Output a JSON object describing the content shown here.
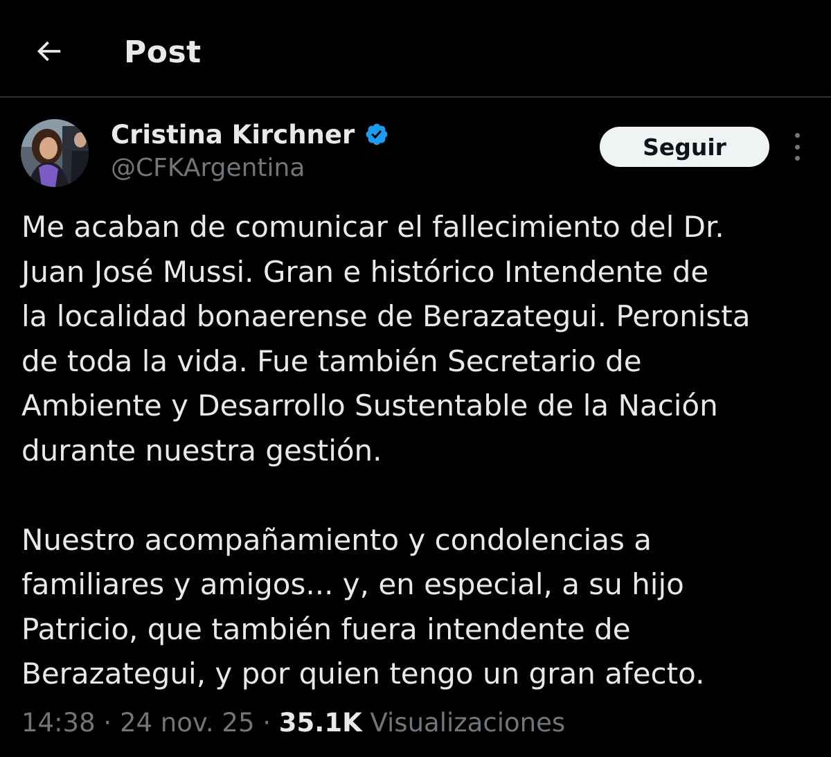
{
  "header": {
    "title": "Post",
    "back_icon": "arrow-left-icon"
  },
  "author": {
    "display_name": "Cristina Kirchner",
    "handle": "@CFKArgentina",
    "verified_icon": "verified-badge-icon",
    "verified_color": "#1d9bf0"
  },
  "actions": {
    "follow_label": "Seguir",
    "more_icon": "more-vertical-icon"
  },
  "tweet": {
    "lines": [
      "Me acaban de comunicar el fallecimiento del Dr.",
      "Juan José Mussi. Gran e histórico Intendente de",
      "la localidad bonaerense de Berazategui. Peronista",
      "de toda la vida. Fue también Secretario de",
      "Ambiente y Desarrollo Sustentable de la Nación",
      "durante nuestra gestión.",
      "",
      "Nuestro acompañamiento y condolencias a",
      "familiares y amigos... y, en especial, a su hijo",
      "Patricio, que también fuera intendente de",
      "Berazategui, y por quien tengo un gran afecto."
    ]
  },
  "meta": {
    "time": "14:38",
    "separator": " · ",
    "date": "24 nov. 25",
    "views_count": "35.1K",
    "views_label": " Visualizaciones"
  },
  "colors": {
    "background": "#000000",
    "text_primary": "#e7e9ea",
    "text_secondary": "#71767b",
    "accent": "#1d9bf0",
    "divider": "#2f3336",
    "button_bg": "#eff3f4"
  }
}
